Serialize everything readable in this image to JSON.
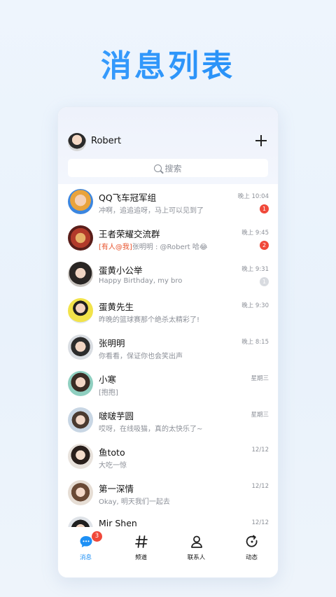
{
  "promo": {
    "title": "消息列表"
  },
  "header": {
    "user_name": "Robert"
  },
  "search": {
    "placeholder": "搜索"
  },
  "chats": [
    {
      "title": "QQ飞车冠军组",
      "preview": "冲啊，追追追呀，马上可以见到了",
      "mention": "",
      "time": "晚上 10:04",
      "badge": "1",
      "badge_style": "red"
    },
    {
      "title": "王者荣耀交流群",
      "preview": "张明明 : @Robert 哈😂",
      "mention": "[有人@我]",
      "time": "晚上 9:45",
      "badge": "2",
      "badge_style": "red"
    },
    {
      "title": "蛋黄小公举",
      "preview": "Happy Birthday, my bro",
      "mention": "",
      "time": "晚上 9:31",
      "badge": "1",
      "badge_style": "gray"
    },
    {
      "title": "蛋黄先生",
      "preview": "昨晚的篮球赛那个绝杀太精彩了!",
      "mention": "",
      "time": "晚上 9:30",
      "badge": "",
      "badge_style": ""
    },
    {
      "title": "张明明",
      "preview": "你看看，保证你也会笑出声",
      "mention": "",
      "time": "晚上 8:15",
      "badge": "",
      "badge_style": ""
    },
    {
      "title": "小寒",
      "preview": "[抱抱]",
      "mention": "",
      "time": "星期三",
      "badge": "",
      "badge_style": ""
    },
    {
      "title": "啵啵芋圆",
      "preview": "哎呀，在线吸猫，真的太快乐了~",
      "mention": "",
      "time": "星期三",
      "badge": "",
      "badge_style": ""
    },
    {
      "title": "鱼toto",
      "preview": "大吃一惊",
      "mention": "",
      "time": "12/12",
      "badge": "",
      "badge_style": ""
    },
    {
      "title": "第一深情",
      "preview": "Okay, 明天我们一起去",
      "mention": "",
      "time": "12/12",
      "badge": "",
      "badge_style": ""
    },
    {
      "title": "Mir Shen",
      "preview": "",
      "mention": "",
      "time": "12/12",
      "badge": "",
      "badge_style": ""
    }
  ],
  "tabbar": {
    "tabs": [
      {
        "label": "消息",
        "icon": "chat-bubble-icon",
        "active": true,
        "badge": "3"
      },
      {
        "label": "频道",
        "icon": "hash-icon",
        "active": false,
        "badge": ""
      },
      {
        "label": "联系人",
        "icon": "contact-person-icon",
        "active": false,
        "badge": ""
      },
      {
        "label": "动态",
        "icon": "refresh-circle-icon",
        "active": false,
        "badge": ""
      }
    ]
  },
  "colors": {
    "accent": "#1e90f5",
    "badge_red": "#f0493a",
    "mention": "#e8542e"
  }
}
